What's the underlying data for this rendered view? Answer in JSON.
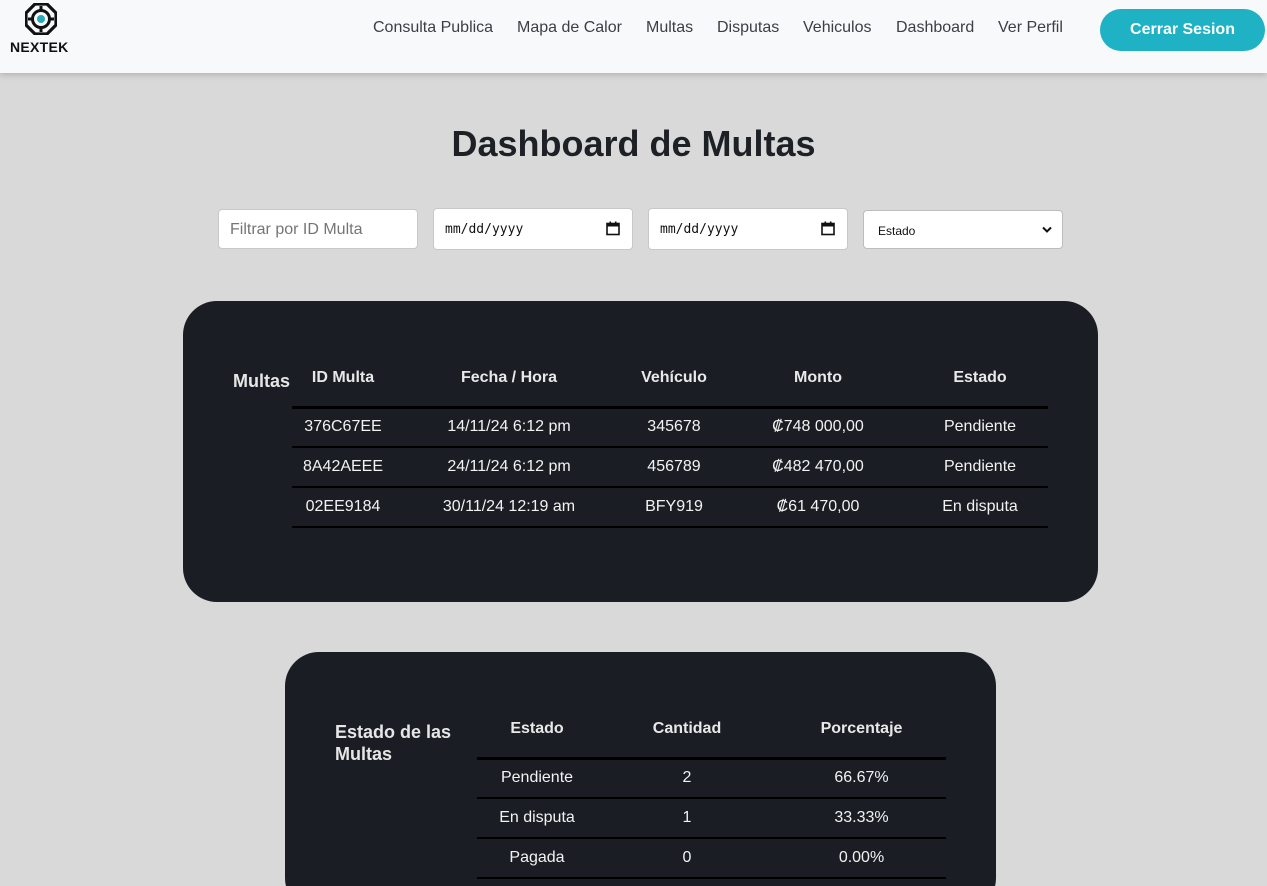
{
  "brand": {
    "name": "NEXTEK",
    "logo_icon": "nextek-logo-icon"
  },
  "nav": {
    "links": [
      "Consulta Publica",
      "Mapa de Calor",
      "Multas",
      "Disputas",
      "Vehiculos",
      "Dashboard",
      "Ver Perfil"
    ],
    "logout_label": "Cerrar Sesion"
  },
  "page": {
    "title": "Dashboard de Multas"
  },
  "filters": {
    "id_placeholder": "Filtrar por ID Multa",
    "date_from": "mm/dd/yyyy",
    "date_to": "mm/dd/yyyy",
    "estado_selected": "Estado"
  },
  "multas_table": {
    "caption": "Multas",
    "headers": [
      "ID Multa",
      "Fecha / Hora",
      "Vehículo",
      "Monto",
      "Estado"
    ],
    "rows": [
      [
        "376C67EE",
        "14/11/24 6:12 pm",
        "345678",
        "₡748 000,00",
        "Pendiente"
      ],
      [
        "8A42AEEE",
        "24/11/24 6:12 pm",
        "456789",
        "₡482 470,00",
        "Pendiente"
      ],
      [
        "02EE9184",
        "30/11/24 12:19 am",
        "BFY919",
        "₡61 470,00",
        "En disputa"
      ]
    ]
  },
  "estado_table": {
    "caption": "Estado de las Multas",
    "headers": [
      "Estado",
      "Cantidad",
      "Porcentaje"
    ],
    "rows": [
      [
        "Pendiente",
        "2",
        "66.67%"
      ],
      [
        "En disputa",
        "1",
        "33.33%"
      ],
      [
        "Pagada",
        "0",
        "0.00%"
      ]
    ]
  },
  "colors": {
    "accent": "#1fb1c4",
    "card_bg": "#1a1e24",
    "page_bg": "#d9d9d9",
    "navbar_bg": "#f8f9fa"
  }
}
